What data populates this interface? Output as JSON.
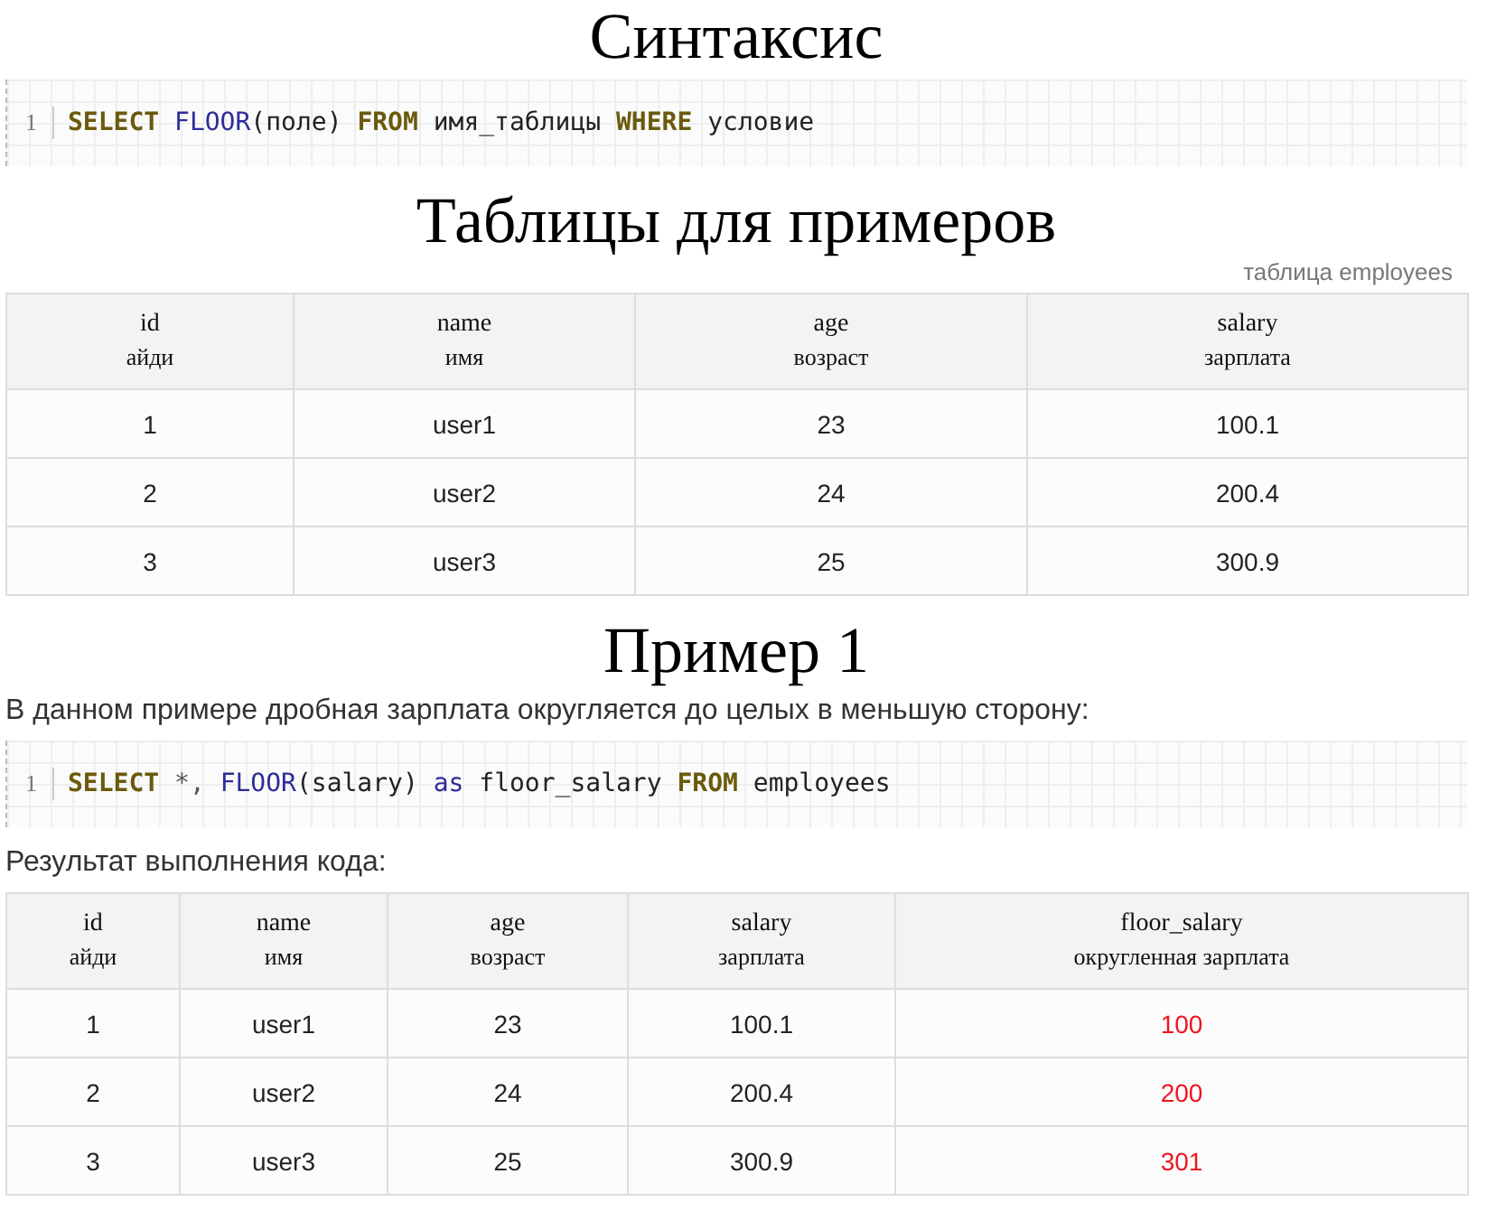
{
  "sections": [
    {
      "kind": "heading",
      "text": "Синтаксис"
    },
    {
      "kind": "code",
      "line_number": "1",
      "tokens": [
        {
          "kind": "keyword",
          "text": "SELECT"
        },
        {
          "kind": "function",
          "text": "FLOOR"
        },
        {
          "kind": "plain",
          "text": "(поле)"
        },
        {
          "kind": "keyword",
          "text": "FROM"
        },
        {
          "kind": "plain",
          "text": "имя_таблицы"
        },
        {
          "kind": "keyword",
          "text": "WHERE"
        },
        {
          "kind": "plain",
          "text": "условие"
        }
      ]
    },
    {
      "kind": "heading",
      "text": "Таблицы для примеров"
    },
    {
      "kind": "caption",
      "text": "таблица employees"
    },
    {
      "kind": "table",
      "columns": [
        {
          "name": "id",
          "translation": "айди",
          "highlighted": false
        },
        {
          "name": "name",
          "translation": "имя",
          "highlighted": false
        },
        {
          "name": "age",
          "translation": "возраст",
          "highlighted": false
        },
        {
          "name": "salary",
          "translation": "зарплата",
          "highlighted": false
        }
      ],
      "rows": [
        [
          "1",
          "user1",
          "23",
          "100.1"
        ],
        [
          "2",
          "user2",
          "24",
          "200.4"
        ],
        [
          "3",
          "user3",
          "25",
          "300.9"
        ]
      ]
    },
    {
      "kind": "heading",
      "text": "Пример 1"
    },
    {
      "kind": "paragraph",
      "text": "В данном примере дробная зарплата округляется до целых в меньшую сторону:"
    },
    {
      "kind": "code",
      "line_number": "1",
      "tokens": [
        {
          "kind": "keyword",
          "text": "SELECT"
        },
        {
          "kind": "operator",
          "text": "*,"
        },
        {
          "kind": "function",
          "text": "FLOOR"
        },
        {
          "kind": "plain",
          "text": "(salary)"
        },
        {
          "kind": "alias",
          "text": "as"
        },
        {
          "kind": "plain",
          "text": "floor_salary"
        },
        {
          "kind": "keyword",
          "text": "FROM"
        },
        {
          "kind": "plain",
          "text": "employees"
        }
      ]
    },
    {
      "kind": "paragraph",
      "text": "Результат выполнения кода:"
    },
    {
      "kind": "table",
      "columns": [
        {
          "name": "id",
          "translation": "айди",
          "highlighted": false
        },
        {
          "name": "name",
          "translation": "имя",
          "highlighted": false
        },
        {
          "name": "age",
          "translation": "возраст",
          "highlighted": false
        },
        {
          "name": "salary",
          "translation": "зарплата",
          "highlighted": false
        },
        {
          "name": "floor_salary",
          "translation": "округленная зарплата",
          "highlighted": true
        }
      ],
      "rows": [
        [
          "1",
          "user1",
          "23",
          "100.1",
          "100"
        ],
        [
          "2",
          "user2",
          "24",
          "200.4",
          "200"
        ],
        [
          "3",
          "user3",
          "25",
          "300.9",
          "301"
        ]
      ]
    }
  ]
}
